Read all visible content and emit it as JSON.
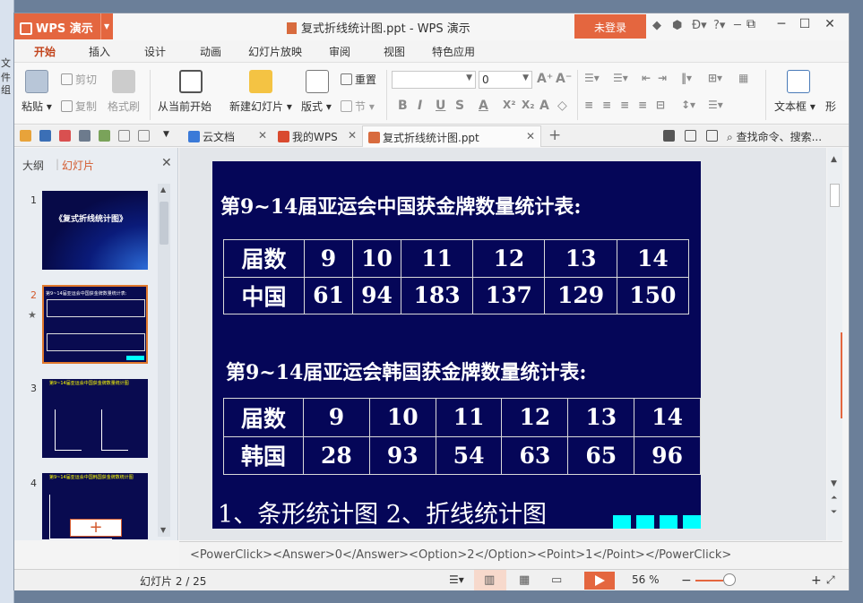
{
  "app": {
    "brand": "WPS 演示",
    "title": "复式折线统计图.ppt - WPS 演示",
    "login": "未登录",
    "title_icons": [
      "help-icon",
      "shield-icon",
      "cloud-icon",
      "skin-icon"
    ],
    "help": "?"
  },
  "left_strip": [
    "文件",
    "组"
  ],
  "ribbon_tabs": [
    "开始",
    "插入",
    "设计",
    "动画",
    "幻灯片放映",
    "审阅",
    "视图",
    "特色应用"
  ],
  "ribbon": {
    "paste": "粘贴",
    "cut": "剪切",
    "copy": "复制",
    "format_painter": "格式刷",
    "from_current": "从当前开始",
    "new_slide": "新建幻灯片",
    "layout": "版式",
    "reset": "重置",
    "section": "节",
    "font_name": "",
    "font_size": "0",
    "textbox": "文本框",
    "shape": "形"
  },
  "quickbar": {
    "tabs": [
      {
        "label": "云文档",
        "active": false
      },
      {
        "label": "我的WPS",
        "active": false
      },
      {
        "label": "复式折线统计图.ppt",
        "active": true
      }
    ],
    "search": "查找命令、搜索..."
  },
  "left_panel": {
    "tab_outline": "大纲",
    "tab_slides": "幻灯片",
    "thumbnails": [
      {
        "number": "1",
        "title": "《复式折线统计图》"
      },
      {
        "number": "2",
        "title": "第9~14届亚运会中国获金牌数量统计表:"
      },
      {
        "number": "3",
        "title": "第9~14届亚运会中国获金牌数量统计图"
      },
      {
        "number": "4",
        "title": "第9~14届亚运会中国韩国获金牌数统计图"
      }
    ],
    "add_slide": "+"
  },
  "slide": {
    "title1": "第9~14届亚运会中国获金牌数量统计表:",
    "table1": {
      "header": [
        "届数",
        "9",
        "10",
        "11",
        "12",
        "13",
        "14"
      ],
      "row": [
        "中国",
        "61",
        "94",
        "183",
        "137",
        "129",
        "150"
      ]
    },
    "title2": "第9~14届亚运会韩国获金牌数量统计表:",
    "table2": {
      "header": [
        "届数",
        "9",
        "10",
        "11",
        "12",
        "13",
        "14"
      ],
      "row": [
        "韩国",
        "28",
        "93",
        "54",
        "63",
        "65",
        "96"
      ]
    },
    "bottom": "1、条形统计图  2、折线统计图",
    "accent_color": "#00ffff"
  },
  "notes": "<PowerClick><Answer>0</Answer><Option>2</Option><Point>1</Point></PowerClick>",
  "status": {
    "slide_counter": "幻灯片 2 / 25",
    "zoom": "56 %",
    "zoom_fraction": 0.56
  }
}
